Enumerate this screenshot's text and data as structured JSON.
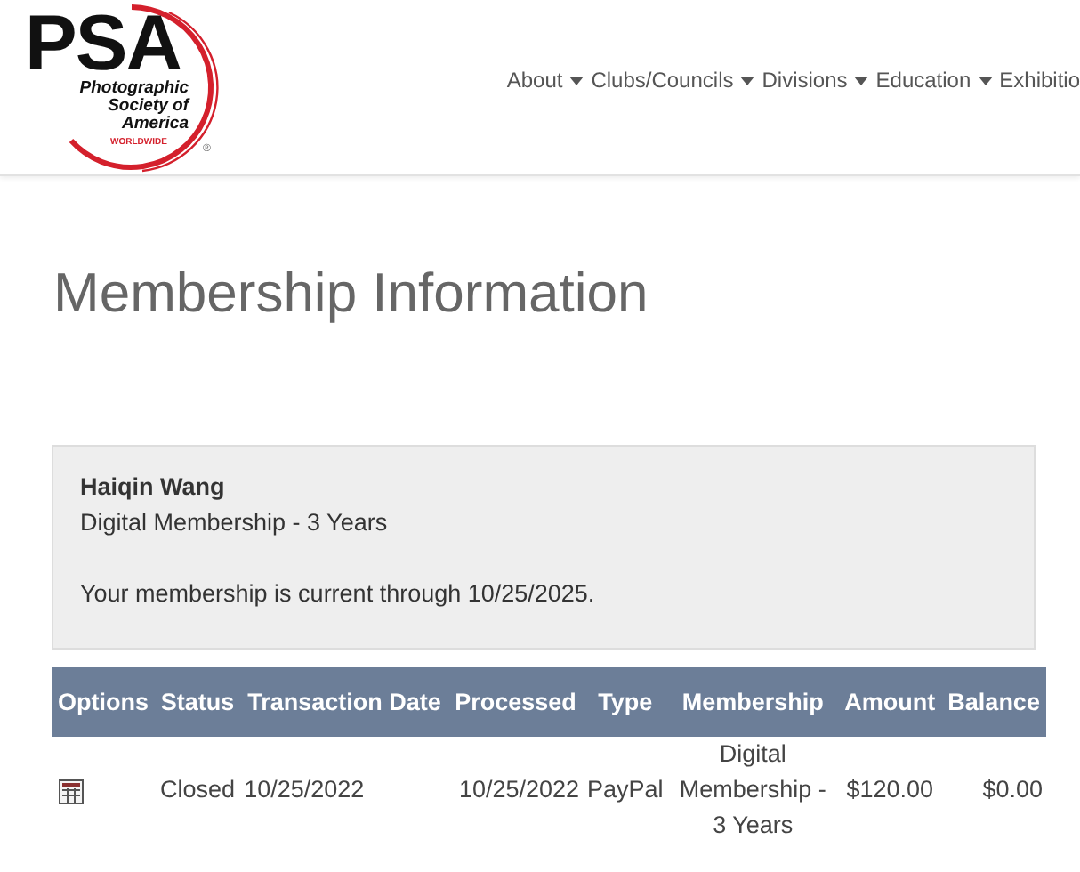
{
  "logo": {
    "initials": "PSA",
    "name": "Photographic Society of America",
    "tagline": "WORLDWIDE",
    "mark": "®"
  },
  "nav": [
    {
      "label": "About",
      "dropdown": true
    },
    {
      "label": "Clubs/Councils",
      "dropdown": true
    },
    {
      "label": "Divisions",
      "dropdown": true
    },
    {
      "label": "Education",
      "dropdown": true
    },
    {
      "label": "Exhibitio",
      "dropdown": false
    }
  ],
  "page_title": "Membership Information",
  "member": {
    "name": "Haiqin Wang",
    "membership": "Digital Membership - 3 Years",
    "status_text": "Your membership is current through 10/25/2025."
  },
  "table": {
    "columns": [
      "Options",
      "Status",
      "Transaction Date",
      "Processed",
      "Type",
      "Membership",
      "Amount",
      "Balance"
    ],
    "rows": [
      {
        "details_button": true,
        "status": "Closed",
        "transaction_date": "10/25/2022",
        "processed": "10/25/2022",
        "type": "PayPal",
        "membership": "Digital Membership - 3 Years",
        "amount": "$120.00",
        "balance": "$0.00"
      }
    ]
  }
}
